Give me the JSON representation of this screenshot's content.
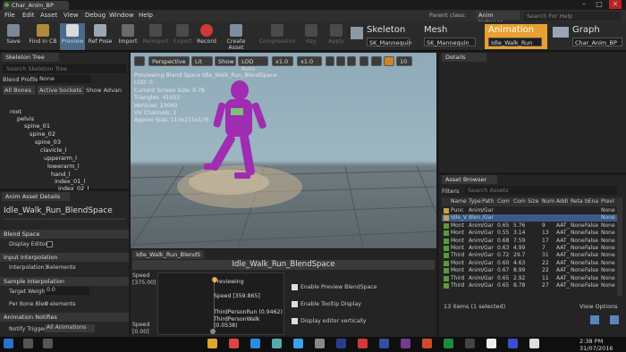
{
  "window": {
    "tab_title": "Char_Anim_BP",
    "controls": [
      "–",
      "□",
      "✕"
    ]
  },
  "menu": {
    "items": [
      "File",
      "Edit",
      "Asset",
      "View",
      "Debug",
      "Window",
      "Help"
    ],
    "parent_class_label": "Parent class:",
    "parent_class_value": "Anim Instance",
    "help_placeholder": "Search For Help"
  },
  "toolbar": {
    "buttons": [
      "Save",
      "Find in CB",
      "Preview",
      "Ref Pose",
      "Import",
      "Reimport",
      "Export",
      "Record",
      "Create Asset",
      "Compression",
      "Key",
      "Apply"
    ]
  },
  "modes": {
    "skeleton": {
      "label": "Skeleton",
      "value": "SK_Mannequin"
    },
    "mesh": {
      "label": "Mesh",
      "value": "SK_Mannequin"
    },
    "animation": {
      "label": "Animation",
      "value": "Idle_Walk_Run"
    },
    "graph": {
      "label": "Graph",
      "value": "Char_Anim_BP"
    }
  },
  "skeleton_tree": {
    "tab": "Skeleton Tree",
    "search_placeholder": "Search Skeleton Tree",
    "blend_profile_label": "Blend Profile:",
    "blend_profile_value": "None",
    "filter_all": "All Bones",
    "filter_active": "Active Sockets",
    "show_advanced": "Show Advan",
    "bones": [
      "root",
      "pelvis",
      "spine_01",
      "spine_02",
      "spine_03",
      "clavicle_l",
      "upperarm_l",
      "lowerarm_l",
      "hand_l",
      "index_01_l",
      "index_02_l"
    ]
  },
  "anim_details": {
    "tab": "Anim Asset Details",
    "search_placeholder": "Search Details",
    "title": "Idle_Walk_Run_BlendSpace",
    "sections": {
      "blend_space": "Blend Space",
      "display_editor": "Display Editor",
      "input_interp": "Input Interpolation",
      "interp_x": "Interpolation X",
      "interp_x_val": "3 elements",
      "sample_interp": "Sample Interpolation",
      "target_weight": "Target Weight",
      "target_weight_val": "0.0",
      "per_bone": "Per Bone Blen",
      "per_bone_val": "0 elements",
      "anim_notifies": "Animation Notifies",
      "notify_trigger": "Notify Trigger",
      "notify_trigger_val": "All Animations"
    }
  },
  "viewport": {
    "buttons": [
      "Perspective",
      "Lit",
      "Show",
      "LOD Auto",
      "x1.0",
      "x1.0",
      "10"
    ],
    "overlay": [
      "Previewing Blend Space Idle_Walk_Run_BlendSpace",
      "LOD: 0",
      "Current Screen Size: 0.78",
      "Triangles: 41052",
      "Vertices: 23000",
      "UV Channels: 1",
      "Approx Size: 113x215x176"
    ]
  },
  "blendspace": {
    "tab": "Idle_Walk_Run_BlendS",
    "title": "Idle_Walk_Run_BlendSpace",
    "speed_label": "Speed",
    "speed_max": "[375.00]",
    "speed_min": "[0.00]",
    "previewing": "Previewing",
    "speed_val": "Speed [359.865]",
    "samples": [
      "ThirdPersonRun (0.9462)",
      "ThirdPersonWalk (0.0538)"
    ],
    "options": [
      "Enable Preview BlendSpace",
      "Enable Tooltip Display",
      "Display editor vertically"
    ]
  },
  "details": {
    "tab": "Details"
  },
  "asset_browser": {
    "tab": "Asset Browser",
    "filters": "Filters",
    "search_placeholder": "Search Assets",
    "columns": [
      "Name",
      "Type",
      "Path",
      "Com",
      "Com",
      "Size",
      "Num",
      "Addi",
      "Reta",
      "bEna",
      "Previ"
    ],
    "rows": [
      [
        "Punc",
        "Anim",
        "/Gar",
        "",
        "",
        "",
        "",
        "",
        "",
        "",
        "None"
      ],
      [
        "Idle_V",
        "Blen",
        "/Gar",
        "",
        "",
        "",
        "",
        "",
        "",
        "",
        "None"
      ],
      [
        "Mont",
        "Anim",
        "/Gar",
        "0.65",
        "5.76",
        "",
        "9",
        "AAT_",
        "None",
        "False",
        "None"
      ],
      [
        "Mont",
        "Anim",
        "/Gar",
        "0.55",
        "3.14",
        "",
        "13",
        "AAT_",
        "None",
        "False",
        "None"
      ],
      [
        "Mont",
        "Anim",
        "/Gar",
        "0.68",
        "7.59",
        "",
        "17",
        "AAT_",
        "None",
        "False",
        "None"
      ],
      [
        "Mont",
        "Anim",
        "/Gar",
        "0.63",
        "4.99",
        "",
        "7",
        "AAT_",
        "None",
        "False",
        "None"
      ],
      [
        "Third",
        "Anim",
        "/Gar",
        "0.72",
        "29.7",
        "",
        "31",
        "AAT_",
        "None",
        "False",
        "None"
      ],
      [
        "Mont",
        "Anim",
        "/Gar",
        "0.60",
        "4.63",
        "",
        "22",
        "AAT_",
        "None",
        "False",
        "None"
      ],
      [
        "Mont",
        "Anim",
        "/Gar",
        "0.67",
        "8.99",
        "",
        "22",
        "AAT_",
        "None",
        "False",
        "None"
      ],
      [
        "Third",
        "Anim",
        "/Gar",
        "0.65",
        "2.92",
        "",
        "11",
        "AAT_",
        "None",
        "False",
        "None"
      ],
      [
        "Third",
        "Anim",
        "/Gar",
        "0.65",
        "8.78",
        "",
        "27",
        "AAT_",
        "None",
        "False",
        "None"
      ]
    ],
    "status": "13 items (1 selected)",
    "view_options": "View Options"
  },
  "taskbar": {
    "time": "2:38 PM",
    "date": "31/07/2016"
  },
  "colors": {
    "accent": "#e8a030",
    "character": "#9a2aa8",
    "floor_grid": "#5b6468"
  }
}
